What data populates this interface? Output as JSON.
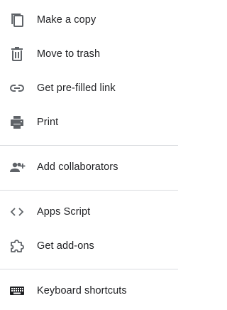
{
  "colors": {
    "icon": "#5f6368",
    "icon_dark": "#202124",
    "text": "#202124",
    "divider": "#dadce0",
    "background": "#ffffff"
  },
  "menu": {
    "items": [
      {
        "label": "Make a copy",
        "icon": "copy-icon"
      },
      {
        "label": "Move to trash",
        "icon": "trash-icon"
      },
      {
        "label": "Get pre-filled link",
        "icon": "link-icon"
      },
      {
        "label": "Print",
        "icon": "print-icon"
      },
      {
        "label": "Add collaborators",
        "icon": "add-collaborators-icon"
      },
      {
        "label": "Apps Script",
        "icon": "code-icon"
      },
      {
        "label": "Get add-ons",
        "icon": "puzzle-icon"
      },
      {
        "label": "Keyboard shortcuts",
        "icon": "keyboard-icon"
      }
    ]
  }
}
